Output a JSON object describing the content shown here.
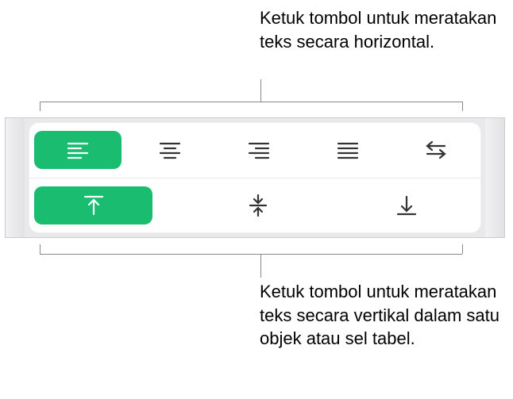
{
  "callouts": {
    "top": "Ketuk tombol untuk meratakan teks secara horizontal.",
    "bottom": "Ketuk tombol untuk meratakan teks secara vertikal dalam satu objek atau sel tabel."
  },
  "toolbar": {
    "horizontal": {
      "buttons": [
        {
          "name": "align-left",
          "selected": true
        },
        {
          "name": "align-center",
          "selected": false
        },
        {
          "name": "align-right",
          "selected": false
        },
        {
          "name": "align-justify",
          "selected": false
        },
        {
          "name": "text-direction",
          "selected": false
        }
      ]
    },
    "vertical": {
      "buttons": [
        {
          "name": "valign-top",
          "selected": true
        },
        {
          "name": "valign-middle",
          "selected": false
        },
        {
          "name": "valign-bottom",
          "selected": false
        }
      ]
    },
    "colors": {
      "selected_bg": "#1abc70",
      "selected_fg": "#ffffff",
      "icon": "#333333"
    }
  }
}
